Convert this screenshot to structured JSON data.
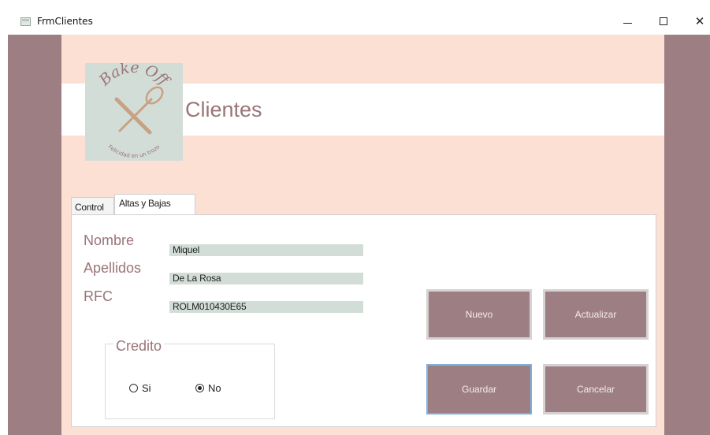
{
  "window": {
    "title": "FrmClientes",
    "controls": {
      "minimize": "minimize-icon",
      "maximize": "maximize-icon",
      "close": "close-icon"
    }
  },
  "header": {
    "logo": {
      "brand": "Bake Off",
      "tagline": "Felicidad en un trozo"
    },
    "title": "Clientes"
  },
  "tabs": [
    {
      "label": "Control",
      "selected": false
    },
    {
      "label": "Altas y Bajas",
      "selected": true
    }
  ],
  "form": {
    "nombre_label": "Nombre",
    "nombre_value": "Miquel",
    "apellidos_label": "Apellidos",
    "apellidos_value": "De La Rosa",
    "rfc_label": "RFC",
    "rfc_value": "ROLM010430E65"
  },
  "credito": {
    "title": "Credito",
    "options": [
      {
        "label": "Si",
        "checked": false
      },
      {
        "label": "No",
        "checked": true
      }
    ]
  },
  "buttons": {
    "nuevo": "Nuevo",
    "actualizar": "Actualizar",
    "guardar": "Guardar",
    "cancelar": "Cancelar"
  },
  "colors": {
    "side_panel": "#9d7e83",
    "main_panel": "#fde0d4",
    "accent_text": "#9a7479",
    "field_bg": "#d3ddd7",
    "logo_bg": "#d3ddd7",
    "focus_border": "#7db2dc"
  }
}
